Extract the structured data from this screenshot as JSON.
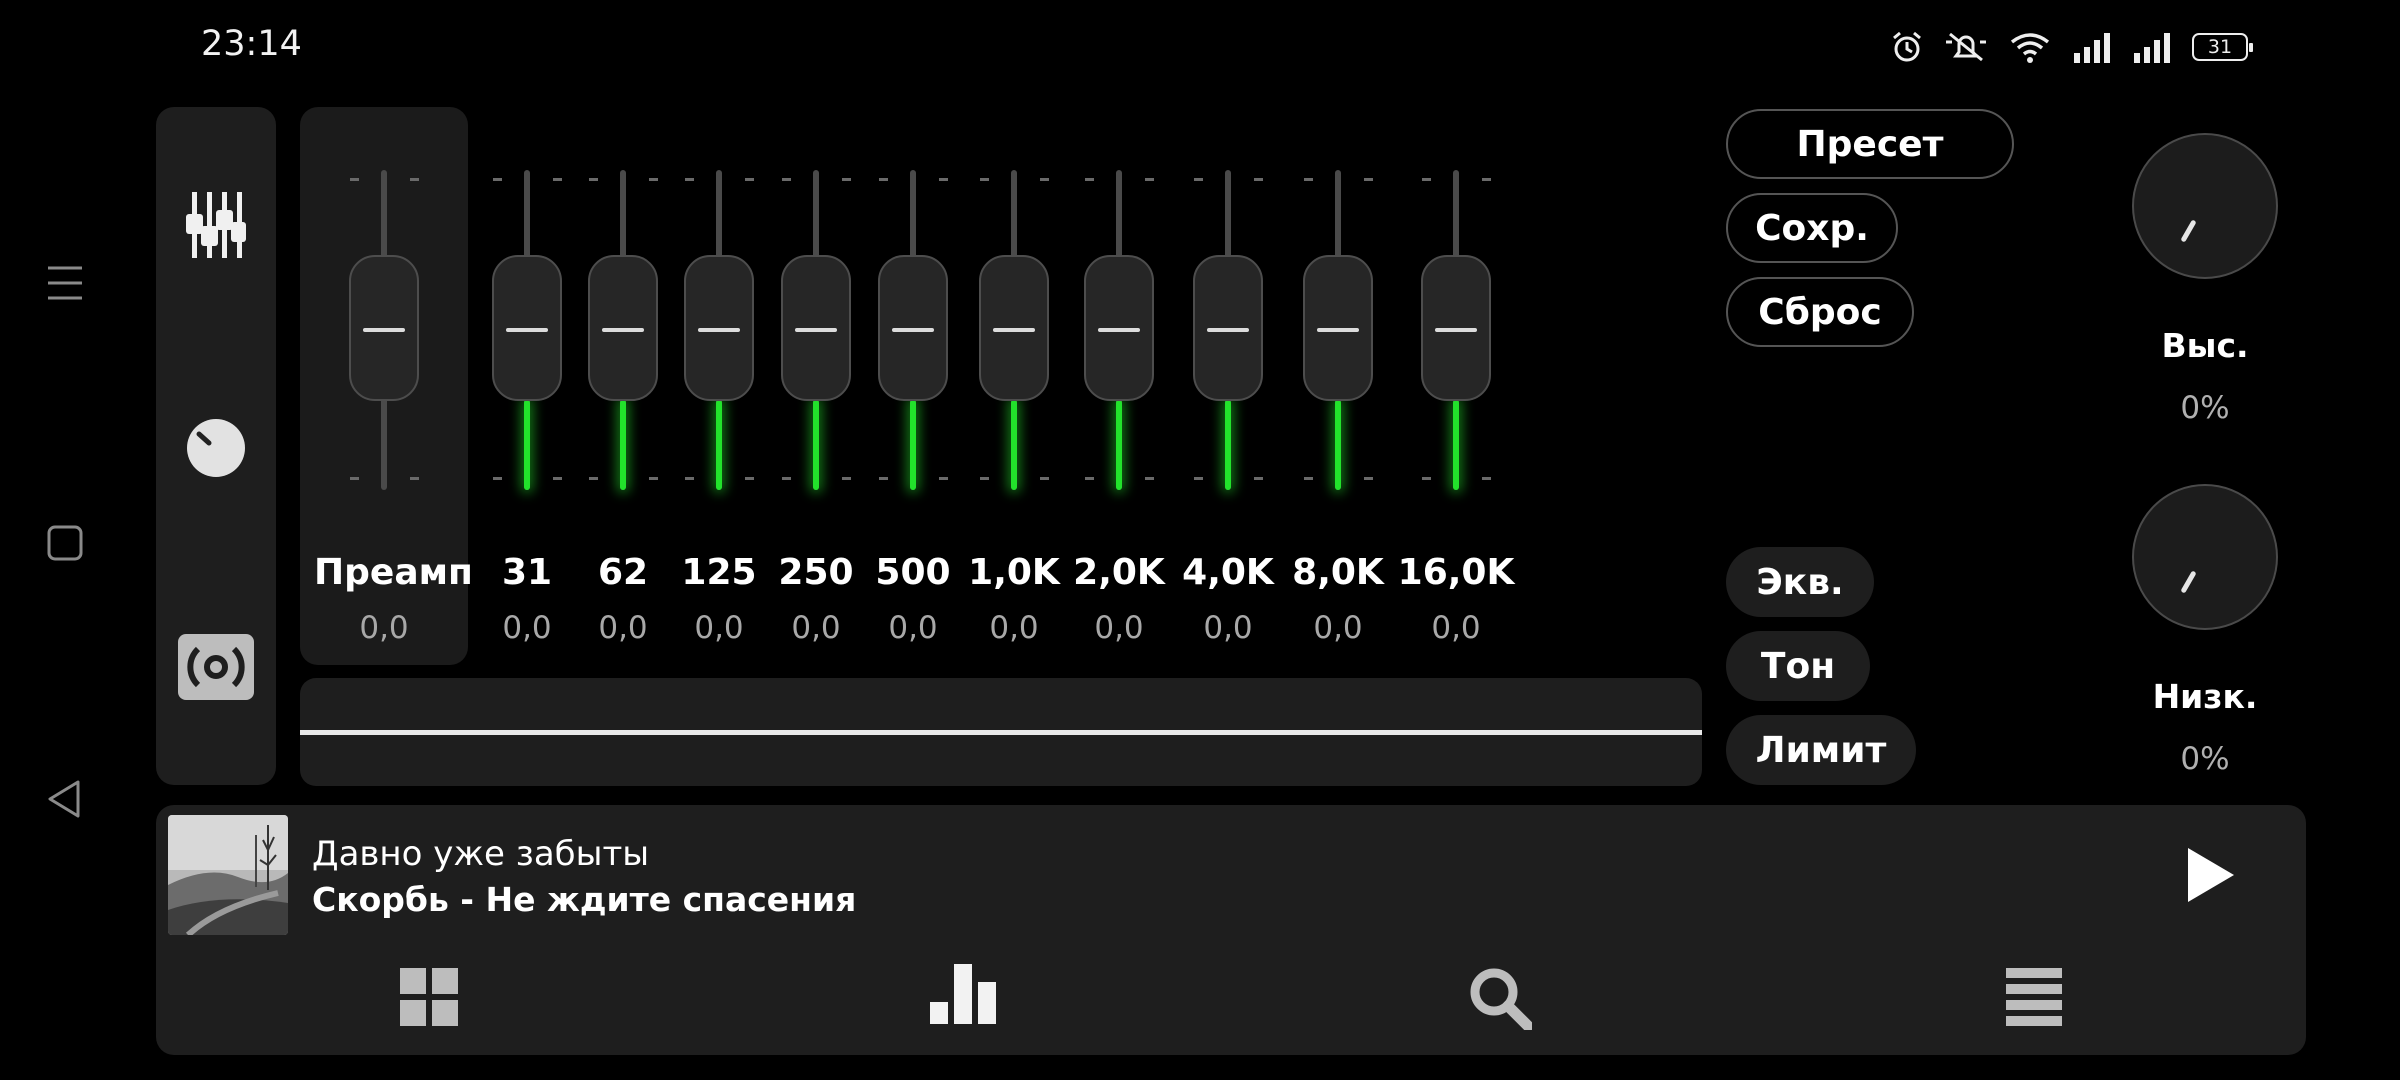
{
  "status_bar": {
    "time": "23:14",
    "battery": "31",
    "icons": [
      "alarm-icon",
      "mute-icon",
      "wifi-icon",
      "signal-icon",
      "signal-icon",
      "battery-icon"
    ]
  },
  "system_nav": {
    "icons": [
      "menu-icon",
      "home-square-icon",
      "back-triangle-icon"
    ]
  },
  "tool_panel": {
    "icons": [
      "equalizer-sliders-icon",
      "knob-icon",
      "speaker-icon"
    ]
  },
  "preamp": {
    "label": "Преамп",
    "value": "0,0"
  },
  "bands": [
    {
      "label": "31",
      "value": "0,0"
    },
    {
      "label": "62",
      "value": "0,0"
    },
    {
      "label": "125",
      "value": "0,0"
    },
    {
      "label": "250",
      "value": "0,0"
    },
    {
      "label": "500",
      "value": "0,0"
    },
    {
      "label": "1,0K",
      "value": "0,0"
    },
    {
      "label": "2,0K",
      "value": "0,0"
    },
    {
      "label": "4,0K",
      "value": "0,0"
    },
    {
      "label": "8,0K",
      "value": "0,0"
    },
    {
      "label": "16,0K",
      "value": "0,0"
    }
  ],
  "buttons": {
    "preset": "Пресет",
    "save": "Сохр.",
    "reset": "Сброс",
    "eq": "Экв.",
    "tone": "Тон",
    "limit": "Лимит"
  },
  "dials": {
    "treble": {
      "label": "Выс.",
      "value": "0%"
    },
    "bass": {
      "label": "Низк.",
      "value": "0%"
    }
  },
  "player": {
    "title": "Давно уже забыты",
    "artist": "Скорбь - Не ждите спасения",
    "play_icon": "play-icon"
  },
  "bottom_nav": {
    "icons": [
      "grid-icon",
      "bar-chart-icon",
      "search-icon",
      "list-icon"
    ]
  },
  "colors": {
    "accent": "#22e32b",
    "background": "#000000",
    "panel": "#1e1e1e"
  }
}
